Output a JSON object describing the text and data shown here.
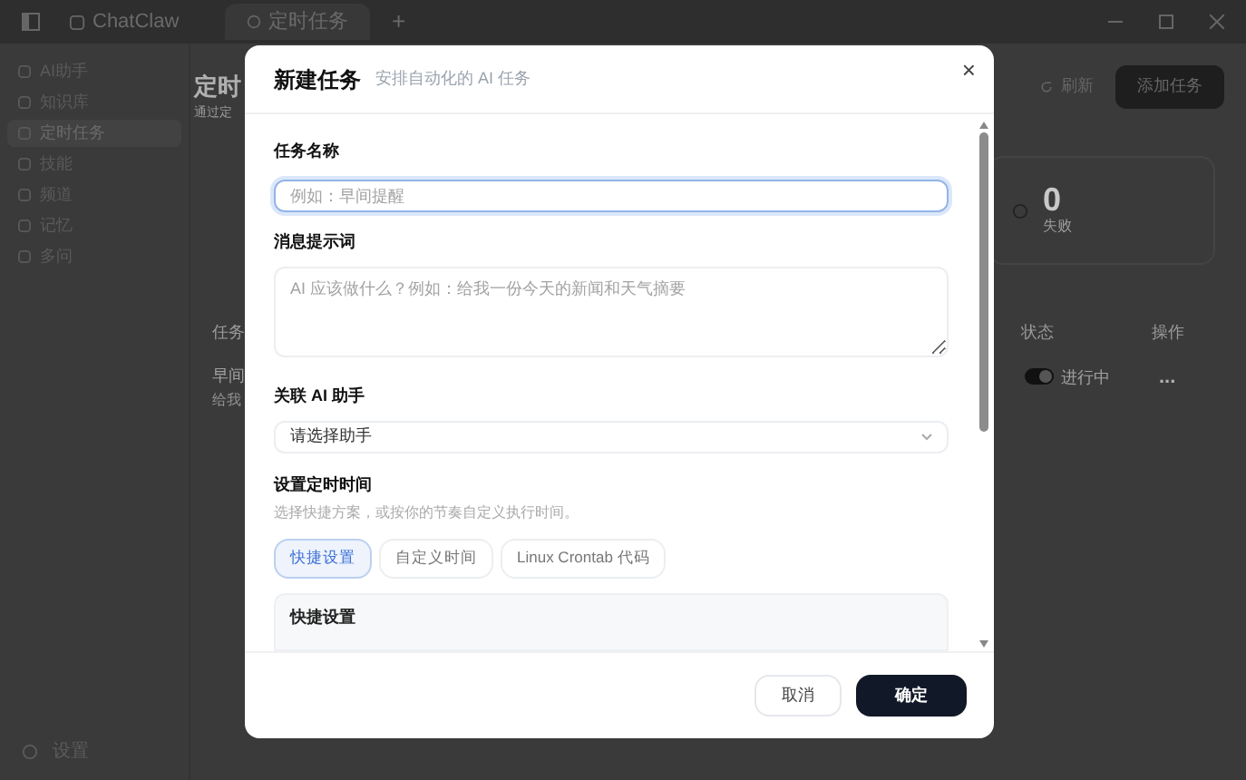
{
  "window": {
    "app_name": "ChatClaw",
    "tabs": [
      {
        "label": "定时任务",
        "selected": true
      }
    ],
    "new_tab": "+"
  },
  "sidebar": {
    "items": [
      {
        "label": "AI助手",
        "selected": false
      },
      {
        "label": "知识库",
        "selected": false
      },
      {
        "label": "定时任务",
        "selected": true
      },
      {
        "label": "技能",
        "selected": false
      },
      {
        "label": "频道",
        "selected": false
      },
      {
        "label": "记忆",
        "selected": false
      },
      {
        "label": "多问",
        "selected": false
      }
    ],
    "settings": "设置"
  },
  "page": {
    "title": "定时",
    "subtitle": "通过定",
    "refresh": "刷新",
    "add": "添加任务",
    "stat": {
      "value": "0",
      "label": "失败"
    },
    "table": {
      "columns": [
        "任务",
        "状态",
        "操作"
      ],
      "rows": [
        {
          "name": "早间",
          "detail": "给我",
          "on": true,
          "status": "进行中",
          "actions": "..."
        }
      ]
    }
  },
  "dialog": {
    "title": "新建任务",
    "subtitle": "安排自动化的 AI 任务",
    "close": "×",
    "name_label": "任务名称",
    "name_placeholder": "例如：早间提醒",
    "prompt_label": "消息提示词",
    "prompt_placeholder": "AI 应该做什么？例如：给我一份今天的新闻和天气摘要",
    "assistant_label": "关联 AI 助手",
    "assistant_value": "请选择助手",
    "schedule_label": "设置定时时间",
    "schedule_hint": "选择快捷方案，或按你的节奏自定义执行时间。",
    "schedule_tabs": [
      {
        "label": "快捷设置",
        "selected": true
      },
      {
        "label": "自定义时间",
        "selected": false
      },
      {
        "label": "Linux Crontab 代码",
        "selected": false
      }
    ],
    "panel_title": "快捷设置",
    "buttons": [
      {
        "label": "取消",
        "kind": "secondary"
      },
      {
        "label": "确定",
        "kind": "primary"
      }
    ]
  }
}
